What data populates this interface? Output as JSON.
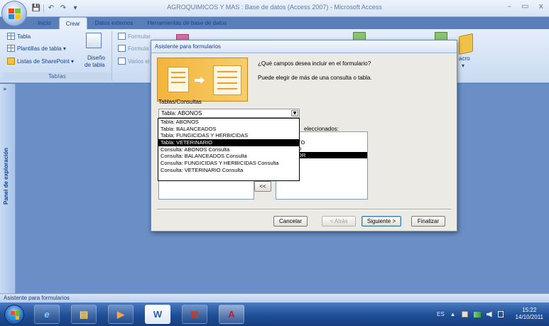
{
  "window": {
    "title": "AGROQUIMICOS Y MAS : Base de datos (Access 2007) - Microsoft Access",
    "controls": [
      "–",
      "▭",
      "x"
    ]
  },
  "qat": {
    "save_icon": "💾",
    "undo_icon": "↶",
    "redo_icon": "↷",
    "more_icon": "▾"
  },
  "ribbon": {
    "tabs": [
      "Inicio",
      "Crear",
      "Datos externos",
      "Herramientas de base de datos"
    ],
    "active_tab": "Crear",
    "tablas": {
      "label": "Tablas",
      "items": [
        "Tabla",
        "Plantillas de tabla ▾",
        "Listas de SharePoint ▾"
      ],
      "design_label_1": "Diseño",
      "design_label_2": "de tabla"
    },
    "forms": {
      "items": [
        "Formular",
        "Formula",
        "Varios el"
      ]
    },
    "macro_label": "acro",
    "macro_arrow": "▾"
  },
  "navpane": {
    "chevron": "»",
    "label": "Panel de exploración"
  },
  "statusbar": {
    "text": "Asistente para formularios"
  },
  "dialog": {
    "title": "Asistente para formularios",
    "question": "¿Qué campos desea incluir en el formulario?",
    "hint": "Puede elegir de más de una consulta o tabla.",
    "tables_label": "Tablas/Consultas",
    "combo_value": "Tabla: ABONOS",
    "combo_arrow": "▼",
    "selected_label": "eleccionados:",
    "selected_fields": [
      "TO",
      "D",
      "OR"
    ],
    "selected_highlight_index": 2,
    "remove_all_button": "<<",
    "buttons": {
      "cancel": "Cancelar",
      "back": "< Atrás",
      "next": "Siguiente >",
      "finish": "Finalizar"
    }
  },
  "dropdown": {
    "options": [
      "Tabla: ABONOS",
      "Tabla: BALANCEADOS",
      "Tabla: FUNGICIDAS Y HERBICIDAS",
      "Tabla: VETERINARIO",
      "Consulta: ABONOS Consulta",
      "Consulta: BALANCEADOS Consulta",
      "Consulta: FUNGICIDAS Y HERBICIDAS Consulta",
      "Consulta: VETERINARIO Consulta"
    ],
    "highlight_index": 3
  },
  "taskbar": {
    "apps": [
      {
        "name": "ie-icon",
        "glyph": "e"
      },
      {
        "name": "explorer-icon",
        "glyph": "▤"
      },
      {
        "name": "media-player-icon",
        "glyph": "▶"
      },
      {
        "name": "word-icon",
        "glyph": "W"
      },
      {
        "name": "powerpoint-icon",
        "glyph": "⊠"
      },
      {
        "name": "access-icon",
        "glyph": "A"
      }
    ],
    "language": "ES",
    "tray_arrow": "▲",
    "clock_time": "15:22",
    "clock_date": "14/10/2011"
  },
  "colors": {
    "ribbon_text": "#15428b",
    "workspace": "#6a8fc6",
    "taskbar": "#1e4e96",
    "highlight": "#000000"
  }
}
